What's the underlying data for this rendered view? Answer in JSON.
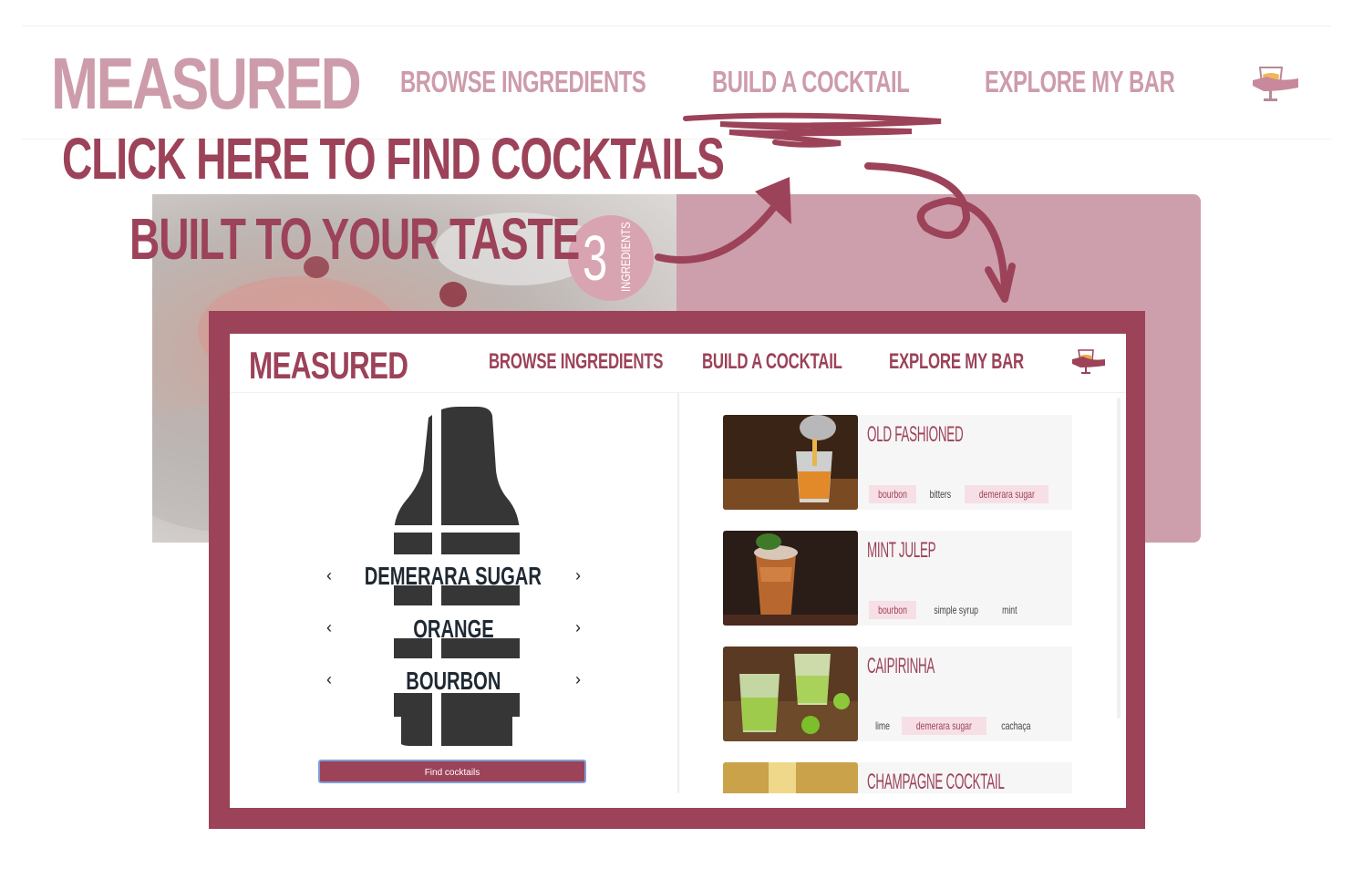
{
  "background_page": {
    "logo": "MEASURED",
    "nav": [
      "BROWSE INGREDIENTS",
      "BUILD A COCKTAIL",
      "EXPLORE MY BAR"
    ],
    "bar_icon": "glass-bar-icon",
    "hero_badge": {
      "number": "3",
      "word": "INGREDIENTS"
    }
  },
  "annotations": {
    "line1": "CLICK HERE TO FIND COCKTAILS",
    "line2": "BUILT TO YOUR TASTE"
  },
  "app": {
    "logo": "MEASURED",
    "nav": {
      "browse": "BROWSE INGREDIENTS",
      "build": "BUILD A COCKTAIL",
      "explore": "EXPLORE MY BAR"
    },
    "selectors": [
      "DEMERARA SUGAR",
      "ORANGE",
      "BOURBON"
    ],
    "find_button": "Find cocktails",
    "results": [
      {
        "title": "OLD FASHIONED",
        "tags": [
          {
            "text": "bourbon",
            "match": true
          },
          {
            "text": "bitters",
            "match": false
          },
          {
            "text": "demerara sugar",
            "match": true
          }
        ]
      },
      {
        "title": "MINT JULEP",
        "tags": [
          {
            "text": "bourbon",
            "match": true
          },
          {
            "text": "simple syrup",
            "match": false
          },
          {
            "text": "mint",
            "match": false
          }
        ]
      },
      {
        "title": "CAIPIRINHA",
        "tags": [
          {
            "text": "lime",
            "match": false
          },
          {
            "text": "demerara sugar",
            "match": true
          },
          {
            "text": "cachaça",
            "match": false
          }
        ]
      },
      {
        "title": "CHAMPAGNE COCKTAIL",
        "tags": []
      }
    ]
  },
  "colors": {
    "brand": "#9c4259",
    "brand_light": "#cd9caa",
    "tag_highlight": "#f7dfe6",
    "button_border": "#7f9ed6"
  }
}
